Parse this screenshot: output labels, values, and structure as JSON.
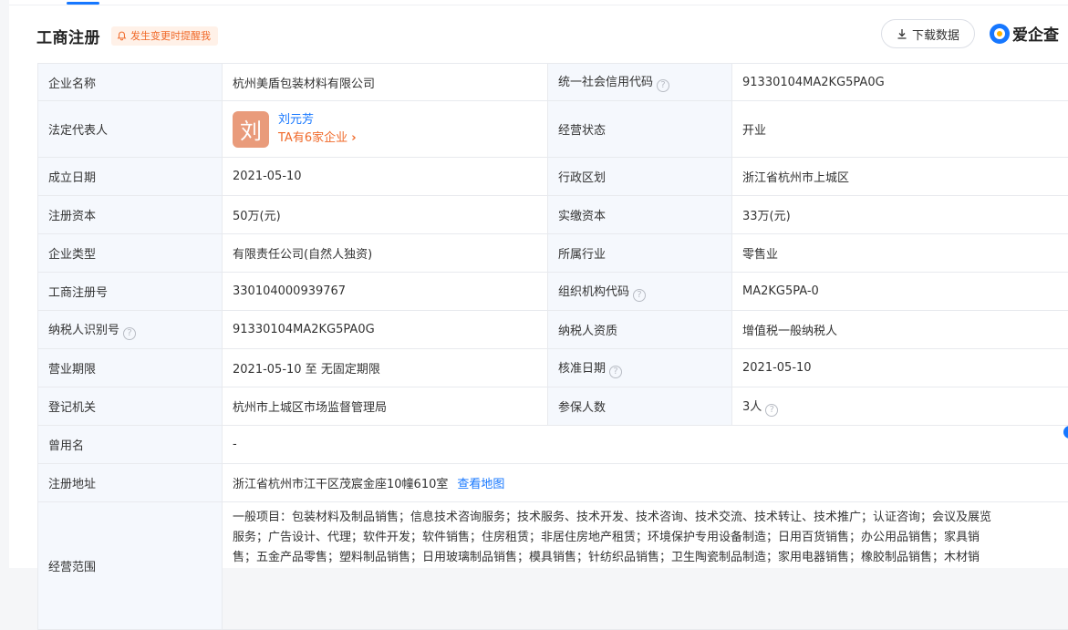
{
  "header": {
    "title": "工商注册",
    "remind_label": "发生变更时提醒我",
    "download_label": "下载数据",
    "logo_text": "爱企查"
  },
  "rows": {
    "r1": {
      "k1": "企业名称",
      "v1": "杭州美盾包装材料有限公司",
      "k2": "统一社会信用代码",
      "v2": "91330104MA2KG5PA0G"
    },
    "r2": {
      "k1": "法定代表人",
      "avatar": "刘",
      "person_name": "刘元芳",
      "person_companies": "TA有6家企业",
      "k2": "经营状态",
      "v2": "开业"
    },
    "r3": {
      "k1": "成立日期",
      "v1": "2021-05-10",
      "k2": "行政区划",
      "v2": "浙江省杭州市上城区"
    },
    "r4": {
      "k1": "注册资本",
      "v1": "50万(元)",
      "k2": "实缴资本",
      "v2": "33万(元)"
    },
    "r5": {
      "k1": "企业类型",
      "v1": "有限责任公司(自然人独资)",
      "k2": "所属行业",
      "v2": "零售业"
    },
    "r6": {
      "k1": "工商注册号",
      "v1": "330104000939767",
      "k2": "组织机构代码",
      "v2": "MA2KG5PA-0"
    },
    "r7": {
      "k1": "纳税人识别号",
      "v1": "91330104MA2KG5PA0G",
      "k2": "纳税人资质",
      "v2": "增值税一般纳税人"
    },
    "r8": {
      "k1": "营业期限",
      "v1": "2021-05-10 至 无固定期限",
      "k2": "核准日期",
      "v2": "2021-05-10"
    },
    "r9": {
      "k1": "登记机关",
      "v1": "杭州市上城区市场监督管理局",
      "k2": "参保人数",
      "v2": "3人"
    },
    "r10": {
      "k1": "曾用名",
      "v1": "-"
    },
    "r11": {
      "k1": "注册地址",
      "v1": "浙江省杭州市江干区茂宸金座10幢610室",
      "link": "查看地图"
    },
    "r12": {
      "k1": "经营范围",
      "line1": "一般项目：包装材料及制品销售；信息技术咨询服务；技术服务、技术开发、技术咨询、技术交流、技术转让、技术推广；认证咨询；会议及展览",
      "line2": "服务；广告设计、代理；软件开发；软件销售；住房租赁；非居住房地产租赁；环境保护专用设备制造；日用百货销售；办公用品销售；家具销",
      "line3": "售；五金产品零售；塑料制品销售；日用玻璃制品销售；模具销售；针纺织品销售；卫生陶瓷制品制造；家用电器销售；橡胶制品销售；木材销"
    }
  },
  "help_glyph": "?",
  "chevron_glyph": "›",
  "colors": {
    "accent": "#1677ff",
    "warn": "#f06a2a",
    "key_bg": "#f5f8fd",
    "avatar_bg": "#e99b7b"
  }
}
